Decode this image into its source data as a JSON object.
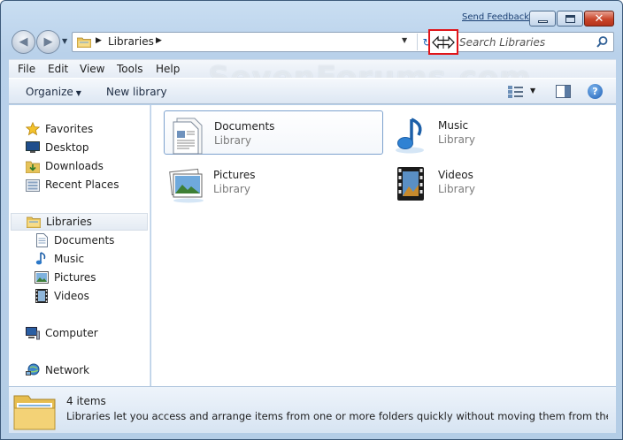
{
  "titlebar": {
    "feedback_link": "Send Feedback",
    "caption_buttons": [
      "minimize",
      "maximize",
      "close"
    ]
  },
  "address_bar": {
    "path": "Libraries",
    "folder_icon": "libraries-folder-icon"
  },
  "search": {
    "placeholder": "Search Libraries"
  },
  "watermark": "SevenForums.com",
  "menu": {
    "items": [
      "File",
      "Edit",
      "View",
      "Tools",
      "Help"
    ]
  },
  "command_bar": {
    "organize": "Organize",
    "new_library": "New library"
  },
  "nav_pane": {
    "favorites": {
      "label": "Favorites",
      "items": [
        "Desktop",
        "Downloads",
        "Recent Places"
      ]
    },
    "libraries": {
      "label": "Libraries",
      "items": [
        "Documents",
        "Music",
        "Pictures",
        "Videos"
      ]
    },
    "computer": "Computer",
    "network": "Network"
  },
  "content": {
    "tiles": [
      {
        "name": "Documents",
        "type": "Library",
        "icon": "documents-library-icon"
      },
      {
        "name": "Music",
        "type": "Library",
        "icon": "music-library-icon"
      },
      {
        "name": "Pictures",
        "type": "Library",
        "icon": "pictures-library-icon"
      },
      {
        "name": "Videos",
        "type": "Library",
        "icon": "videos-library-icon"
      }
    ]
  },
  "details": {
    "count": "4 items",
    "description": "Libraries let you access and arrange items from one or more folders quickly without moving them from their origi..."
  },
  "colors": {
    "frame": "#b9d1ea",
    "highlight_box": "#e0151a",
    "selection_border": "#7da2ce",
    "secondary_text": "#7b7b7b"
  }
}
